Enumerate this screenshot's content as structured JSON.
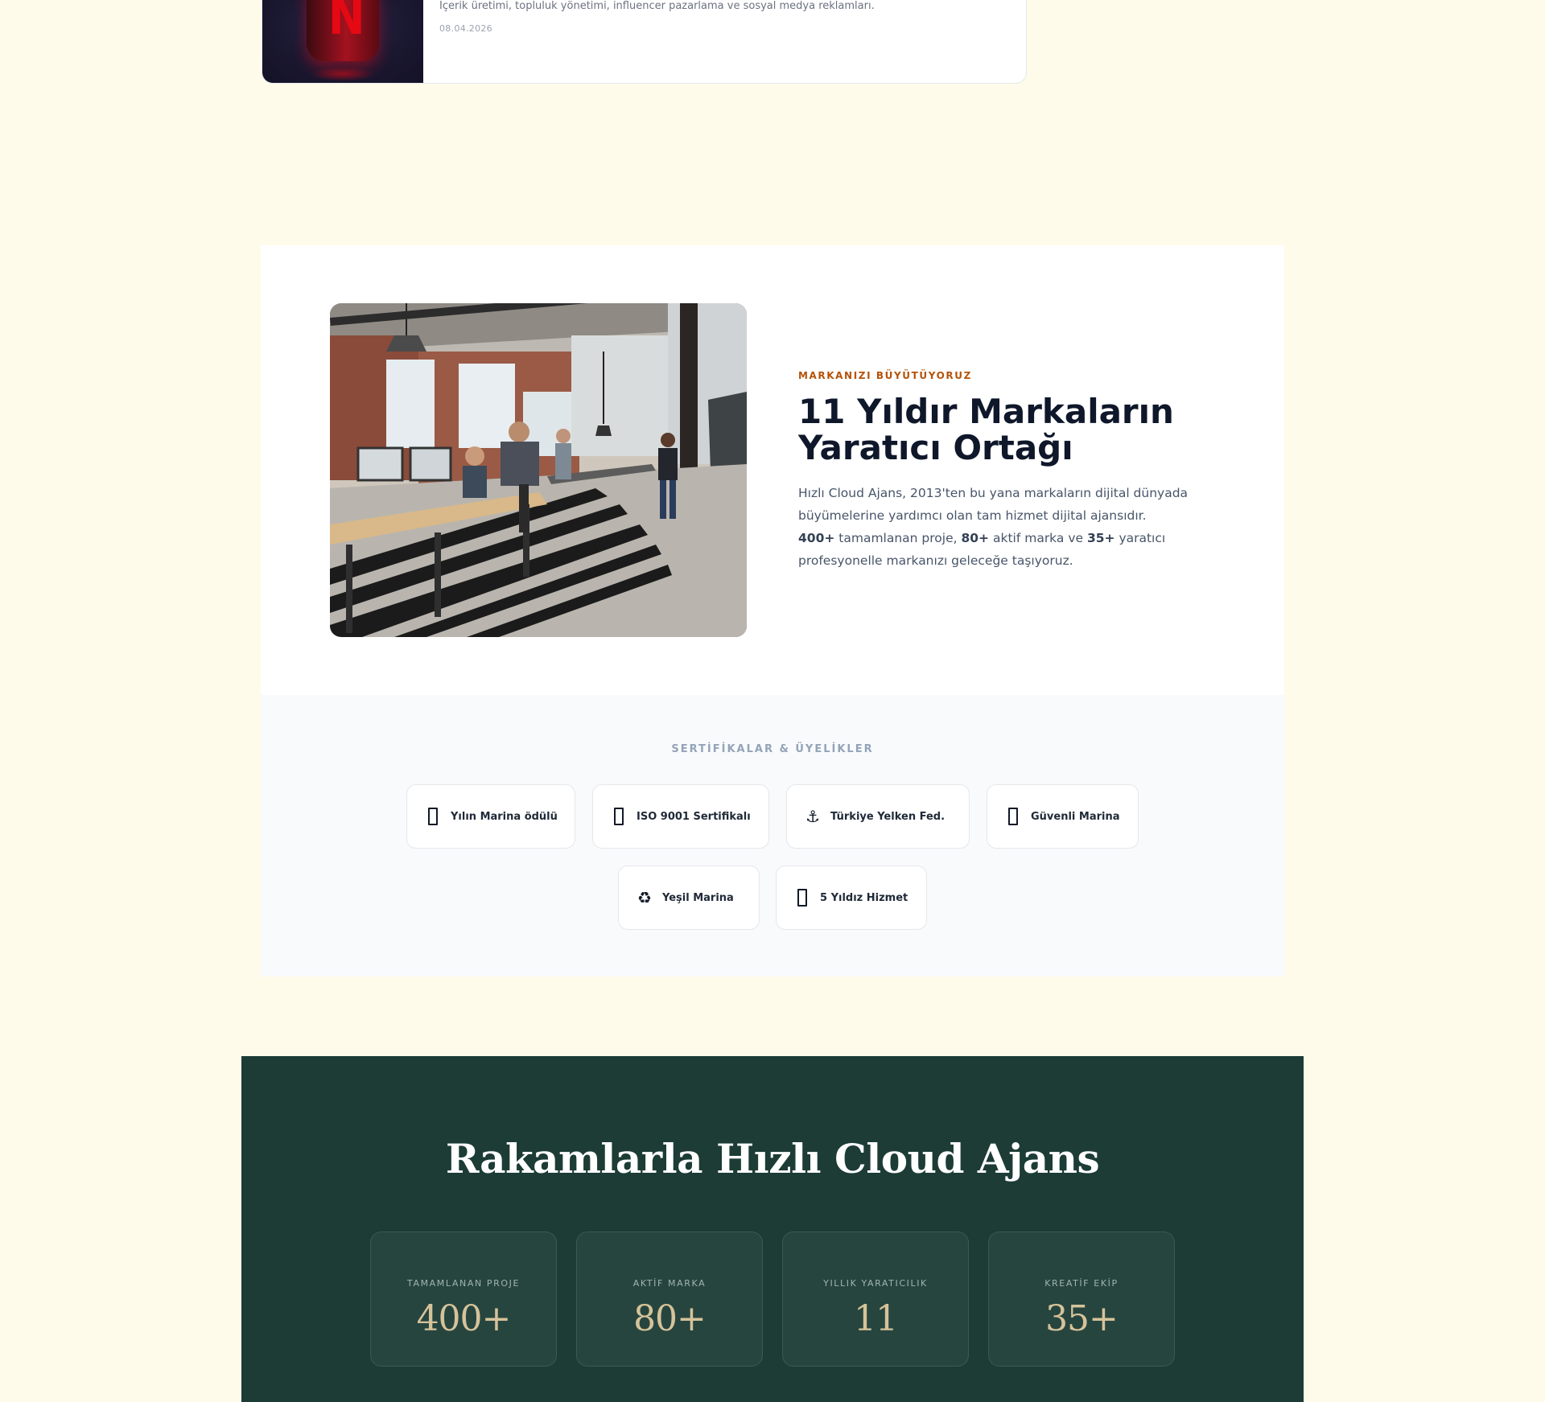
{
  "blog": {
    "description": "İçerik üretimi, topluluk yönetimi, influencer pazarlama ve sosyal medya reklamları.",
    "date": "08.04.2026",
    "thumb_letter": "N"
  },
  "about": {
    "eyebrow": "MARKANIZI BÜYÜTÜYORUZ",
    "title_line1": "11 Yıldır Markaların",
    "title_line2": "Yaratıcı Ortağı",
    "para_intro": "Hızlı Cloud Ajans, 2013'ten bu yana markaların dijital dünyada büyümelerine yardımcı olan tam hizmet dijital ajansıdır.",
    "para_stat1": "400+",
    "para_text1": " tamamlanan proje, ",
    "para_stat2": "80+",
    "para_text2": " aktif marka ve ",
    "para_stat3": "35+",
    "para_text3": " yaratıcı profesyonelle markanızı geleceğe taşıyoruz."
  },
  "certificates": {
    "title": "SERTİFİKALAR & ÜYELİKLER",
    "items": [
      {
        "label": "Yılın Marina ödülü",
        "icon": "trophy-icon"
      },
      {
        "label": "ISO 9001 Sertifikalı",
        "icon": "certificate-icon"
      },
      {
        "label": "Türkiye Yelken Fed.",
        "icon": "anchor-icon",
        "glyph": "⚓"
      },
      {
        "label": "Güvenli Marina",
        "icon": "shield-icon"
      },
      {
        "label": "Yeşil Marina",
        "icon": "recycle-icon",
        "glyph": "♻"
      },
      {
        "label": "5 Yıldız Hizmet",
        "icon": "star-icon"
      }
    ]
  },
  "stats": {
    "title": "Rakamlarla Hızlı Cloud Ajans",
    "items": [
      {
        "label": "TAMAMLANAN PROJE",
        "value": "400+"
      },
      {
        "label": "AKTİF MARKA",
        "value": "80+"
      },
      {
        "label": "YILLIK YARATICILIK",
        "value": "11"
      },
      {
        "label": "KREATİF EKİP",
        "value": "35+"
      }
    ]
  },
  "colors": {
    "page_bg": "#fefbea",
    "accent": "#b45309",
    "stats_bg": "#1c3c35",
    "stats_value": "#d6c39a"
  }
}
